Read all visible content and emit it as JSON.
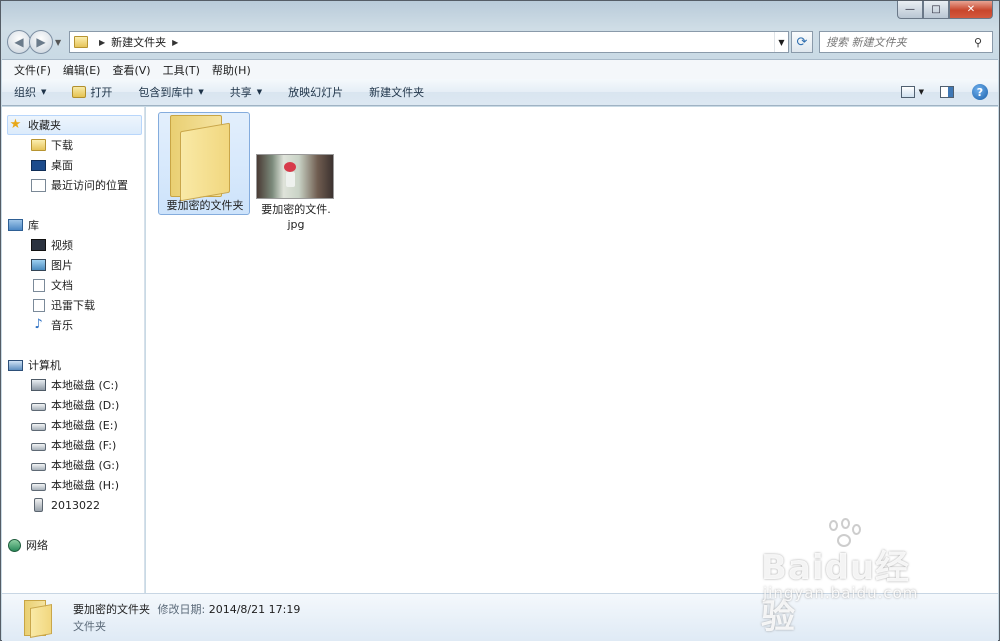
{
  "window": {
    "minimize_glyph": "—",
    "maximize_glyph": "□",
    "close_glyph": "✕"
  },
  "address": {
    "crumbs": [
      "新建文件夹"
    ],
    "search_placeholder": "搜索 新建文件夹"
  },
  "menubar": [
    "文件(F)",
    "编辑(E)",
    "查看(V)",
    "工具(T)",
    "帮助(H)"
  ],
  "commandbar": {
    "organize": "组织",
    "open": "打开",
    "include_in_library": "包含到库中",
    "share": "共享",
    "slideshow": "放映幻灯片",
    "new_folder": "新建文件夹",
    "help_glyph": "?"
  },
  "navpane": {
    "favorites": {
      "label": "收藏夹",
      "items": [
        "下载",
        "桌面",
        "最近访问的位置"
      ]
    },
    "libraries": {
      "label": "库",
      "items": [
        "视频",
        "图片",
        "文档",
        "迅雷下载",
        "音乐"
      ]
    },
    "computer": {
      "label": "计算机",
      "items": [
        "本地磁盘 (C:)",
        "本地磁盘 (D:)",
        "本地磁盘 (E:)",
        "本地磁盘 (F:)",
        "本地磁盘 (G:)",
        "本地磁盘 (H:)",
        "2013022"
      ]
    },
    "network": {
      "label": "网络"
    }
  },
  "files": [
    {
      "name": "要加密的文件夹",
      "type": "folder",
      "selected": true
    },
    {
      "name_line1": "要加密的文件.",
      "name_line2": "jpg",
      "type": "image",
      "selected": false
    }
  ],
  "details": {
    "name": "要加密的文件夹",
    "modified_label": "修改日期:",
    "modified_value": "2014/8/21 17:19",
    "type": "文件夹"
  },
  "watermark": {
    "brand": "Baidu经验",
    "url": "jingyan.baidu.com"
  }
}
